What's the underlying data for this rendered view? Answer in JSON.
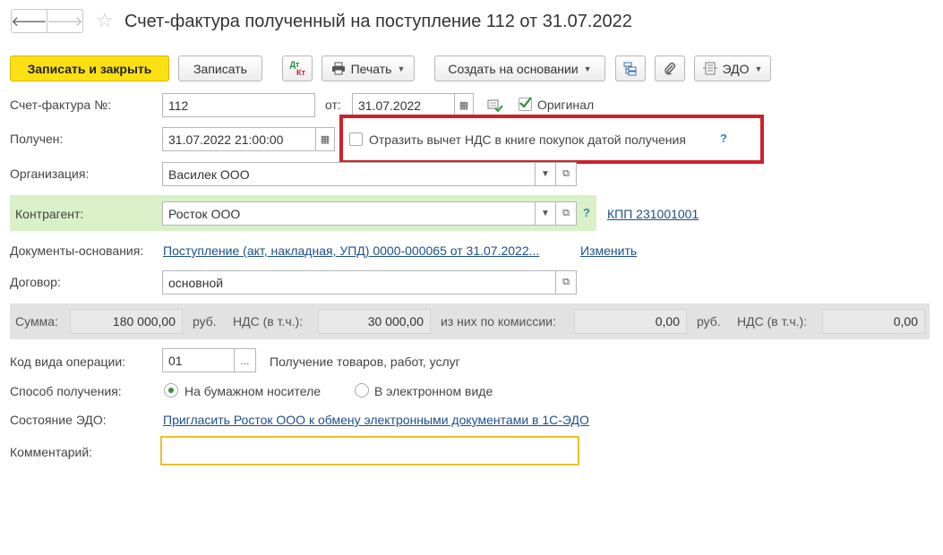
{
  "header": {
    "title": "Счет-фактура полученный на поступление 112 от 31.07.2022",
    "back_glyph": "🡐",
    "forward_glyph": "🡒",
    "star_glyph": "☆"
  },
  "toolbar": {
    "save_close": "Записать и закрыть",
    "save": "Записать",
    "dtkt_top": "Дт",
    "dtkt_bottom": "Кт",
    "print": "Печать",
    "create_based": "Создать на основании",
    "edo": "ЭДО"
  },
  "form": {
    "invoice_no_label": "Счет-фактура №:",
    "invoice_no_value": "112",
    "from_label": "от:",
    "date_value": "31.07.2022",
    "original_label": "Оригинал",
    "original_checked": true,
    "received_label": "Получен:",
    "received_value": "31.07.2022 21:00:00",
    "reflect_vat_label": "Отразить вычет НДС в книге покупок датой получения",
    "reflect_vat_checked": false,
    "help_glyph": "?",
    "org_label": "Организация:",
    "org_value": "Василек ООО",
    "counterparty_label": "Контрагент:",
    "counterparty_value": "Росток ООО",
    "kpp_link": "КПП 231001001",
    "base_docs_label": "Документы-основания:",
    "base_docs_link": "Поступление (акт, накладная, УПД) 0000-000065 от 31.07.2022...",
    "change_link": "Изменить",
    "contract_label": "Договор:",
    "contract_value": "основной",
    "op_code_label": "Код вида операции:",
    "op_code_value": "01",
    "op_code_desc": "Получение товаров, работ, услуг",
    "receipt_method_label": "Способ получения:",
    "receipt_paper": "На бумажном носителе",
    "receipt_electronic": "В электронном виде",
    "receipt_selected": "paper",
    "edo_state_label": "Состояние ЭДО:",
    "edo_invite_link": "Пригласить Росток ООО к обмену электронными документами в 1С-ЭДО",
    "comment_label": "Комментарий:",
    "comment_value": ""
  },
  "sums": {
    "sum_label": "Сумма:",
    "sum_value": "180 000,00",
    "currency1": "руб.",
    "vat_label": "НДС (в т.ч.):",
    "vat_value": "30 000,00",
    "commission_label": "из них по комиссии:",
    "commission_value": "0,00",
    "currency2": "руб.",
    "vat2_label": "НДС (в т.ч.):",
    "vat2_value": "0,00"
  },
  "colors": {
    "primary_button": "#fbe113",
    "highlight_box": "#d0202a",
    "counterparty_bg": "#d9f0c8",
    "comment_border": "#e6c22b",
    "link": "#1c4f8a"
  }
}
